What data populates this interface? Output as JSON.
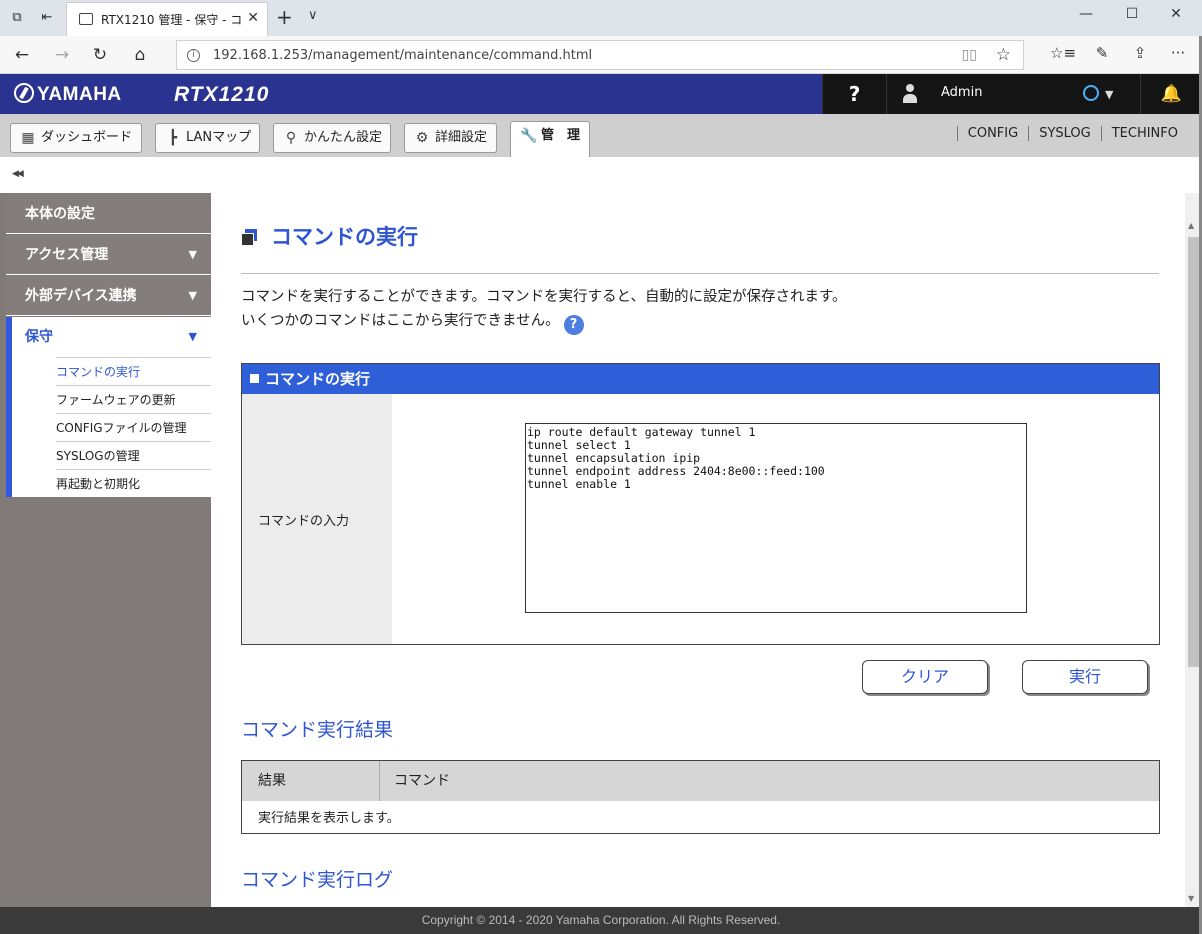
{
  "browser": {
    "tab_title": "RTX1210 管理 - 保守 - コ",
    "tab_close": "✕",
    "new_tab": "+",
    "tab_list": "∨",
    "url": "192.168.1.253/management/maintenance/command.html",
    "window_buttons": [
      "—",
      "☐",
      "✕"
    ],
    "nav": {
      "back": "←",
      "forward": "→",
      "refresh": "↻",
      "home": "⌂"
    }
  },
  "header": {
    "brand": "YAMAHA",
    "model": "RTX1210",
    "help": "?",
    "user": "Admin"
  },
  "menu": {
    "items": [
      {
        "label": "ダッシュボード",
        "icon": "▦"
      },
      {
        "label": "LANマップ",
        "icon": "┣"
      },
      {
        "label": "かんたん設定",
        "icon": "⚲"
      },
      {
        "label": "詳細設定",
        "icon": "⚙"
      },
      {
        "label": "管　理",
        "icon": "🔧"
      }
    ],
    "links": [
      "CONFIG",
      "SYSLOG",
      "TECHINFO"
    ]
  },
  "sidebar": {
    "collapse": "◀◀",
    "sections": [
      {
        "label": "本体の設定",
        "caret": ""
      },
      {
        "label": "アクセス管理",
        "caret": "▼"
      },
      {
        "label": "外部デバイス連携",
        "caret": "▼"
      }
    ],
    "open_section": {
      "label": "保守",
      "caret": "▼"
    },
    "sub_items": [
      "コマンドの実行",
      "ファームウェアの更新",
      "CONFIGファイルの管理",
      "SYSLOGの管理",
      "再起動と初期化"
    ]
  },
  "main": {
    "title": "コマンドの実行",
    "desc_line1": "コマンドを実行することができます。コマンドを実行すると、自動的に設定が保存されます。",
    "desc_line2": "いくつかのコマンドはここから実行できません。",
    "help_badge": "?",
    "panel_title": "コマンドの実行",
    "input_label": "コマンドの入力",
    "commands": "ip route default gateway tunnel 1\ntunnel select 1\ntunnel encapsulation ipip\ntunnel endpoint address 2404:8e00::feed:100\ntunnel enable 1",
    "clear_button": "クリア",
    "execute_button": "実行",
    "result_heading": "コマンド実行結果",
    "result_col1": "結果",
    "result_col2": "コマンド",
    "result_placeholder": "実行結果を表示します。",
    "log_heading": "コマンド実行ログ"
  },
  "footer": "Copyright © 2014 - 2020 Yamaha Corporation. All Rights Reserved."
}
